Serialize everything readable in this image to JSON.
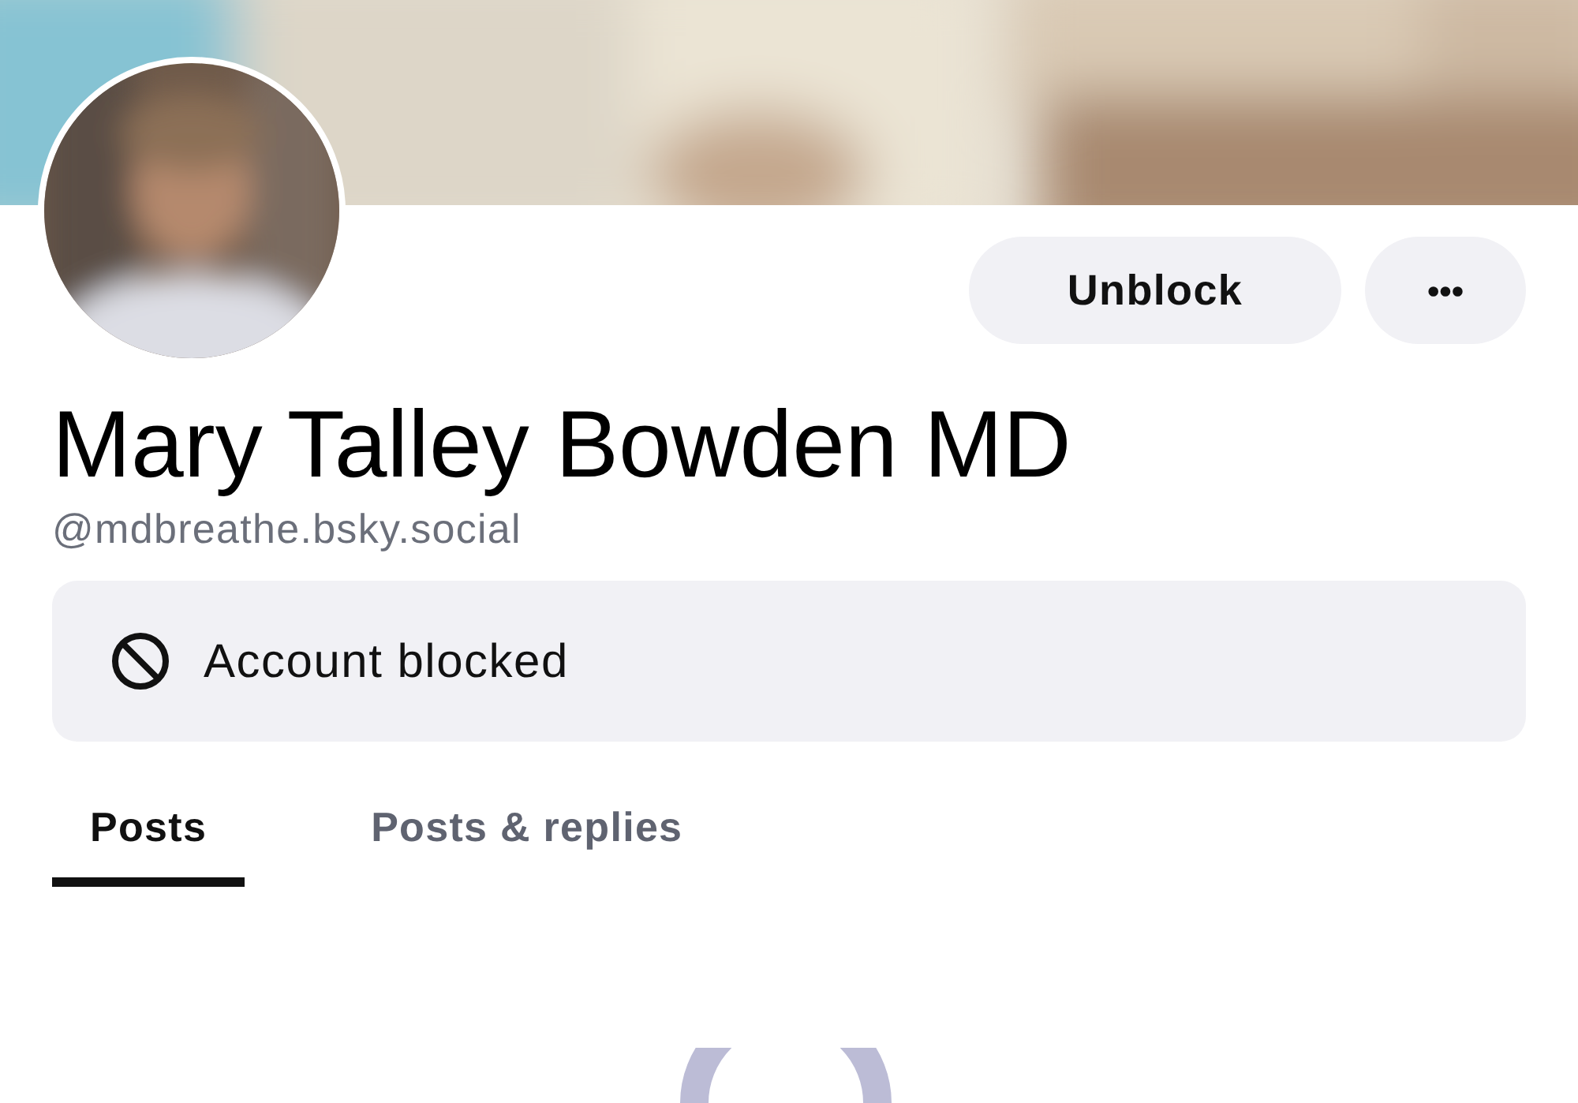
{
  "profile": {
    "name": "Mary Talley Bowden MD",
    "handle": "@mdbreathe.bsky.social"
  },
  "actions": {
    "unblock": "Unblock",
    "more": "•••"
  },
  "notice": {
    "text": "Account blocked"
  },
  "tabs": [
    {
      "label": "Posts",
      "selected": true
    },
    {
      "label": "Posts & replies",
      "selected": false
    }
  ]
}
